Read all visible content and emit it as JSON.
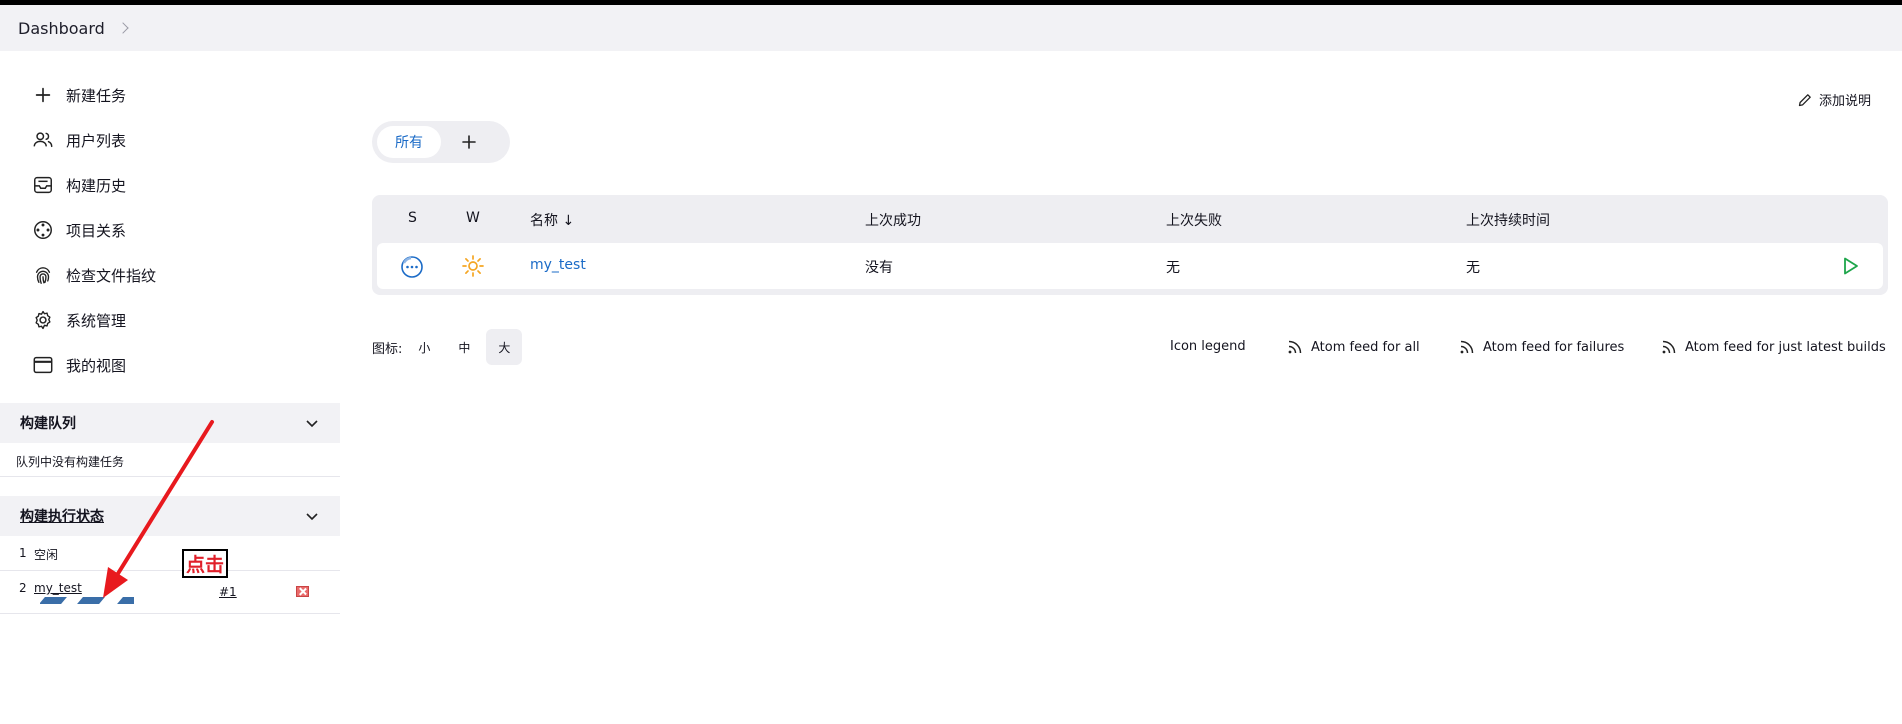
{
  "breadcrumb": {
    "items": [
      "Dashboard"
    ]
  },
  "sidebar": {
    "tasks": [
      {
        "label": "新建任务",
        "icon": "plus-icon"
      },
      {
        "label": "用户列表",
        "icon": "users-icon"
      },
      {
        "label": "构建历史",
        "icon": "inbox-icon"
      },
      {
        "label": "项目关系",
        "icon": "relationship-icon"
      },
      {
        "label": "检查文件指纹",
        "icon": "fingerprint-icon"
      },
      {
        "label": "系统管理",
        "icon": "gear-icon"
      },
      {
        "label": "我的视图",
        "icon": "window-icon"
      }
    ],
    "build_queue": {
      "title": "构建队列",
      "empty_text": "队列中没有构建任务"
    },
    "executors": {
      "title": "构建执行状态",
      "rows": [
        {
          "num": "1",
          "status": "空闲"
        },
        {
          "num": "2",
          "job": "my_test",
          "build": "#1"
        }
      ]
    }
  },
  "main": {
    "add_description": "添加说明",
    "tabs": [
      {
        "label": "所有"
      }
    ],
    "table": {
      "headers": {
        "s": "S",
        "w": "W",
        "name": "名称 ↓",
        "last_success": "上次成功",
        "last_failure": "上次失败",
        "last_duration": "上次持续时间"
      },
      "rows": [
        {
          "name": "my_test",
          "last_success": "没有",
          "last_failure": "无",
          "last_duration": "无",
          "status_icon": "in-progress-icon",
          "weather_icon": "sun-icon"
        }
      ]
    },
    "icon_size": {
      "label": "图标:",
      "options": [
        "小",
        "中",
        "大"
      ],
      "selected": "大"
    },
    "footer_links": {
      "legend": "Icon legend",
      "atom_all": "Atom feed for all",
      "atom_failures": "Atom feed for failures",
      "atom_latest": "Atom feed for just latest builds"
    }
  },
  "annotation": {
    "text": "点击",
    "color": "#e0202a"
  },
  "colors": {
    "link": "#1b6bc7",
    "success_green": "#1ea64b",
    "sun": "#f5a623"
  }
}
